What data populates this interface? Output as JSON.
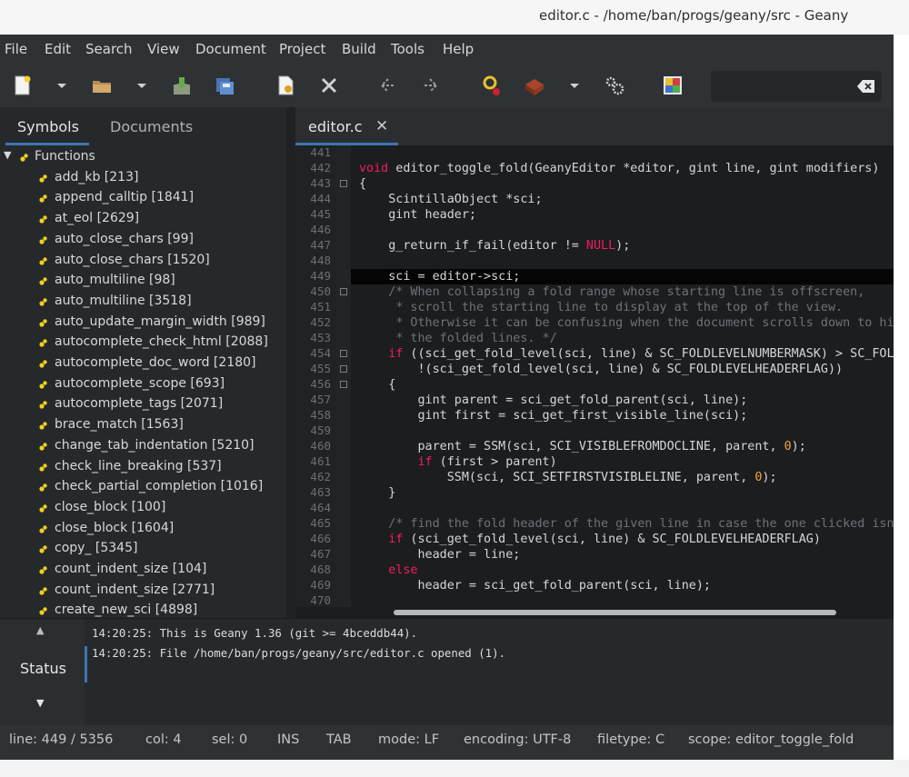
{
  "window": {
    "title": "editor.c - /home/ban/progs/geany/src - Geany"
  },
  "menu": [
    "File",
    "Edit",
    "Search",
    "View",
    "Document",
    "Project",
    "Build",
    "Tools",
    "Help"
  ],
  "toolbar": {
    "buttons": [
      "new-file",
      "new-dropdown",
      "open-file",
      "open-dropdown",
      "save",
      "save-all",
      "revert",
      "close",
      "navigate-back",
      "navigate-forward",
      "compile",
      "build",
      "build-dropdown",
      "run-preferences",
      "color-chooser"
    ],
    "search": {
      "value": "",
      "placeholder": ""
    }
  },
  "sidebar": {
    "tabs": [
      "Symbols",
      "Documents"
    ],
    "active_tab": "Symbols",
    "group": "Functions",
    "symbols": [
      "add_kb [213]",
      "append_calltip [1841]",
      "at_eol [2629]",
      "auto_close_chars [99]",
      "auto_close_chars [1520]",
      "auto_multiline [98]",
      "auto_multiline [3518]",
      "auto_update_margin_width [989]",
      "autocomplete_check_html [2088]",
      "autocomplete_doc_word [2180]",
      "autocomplete_scope [693]",
      "autocomplete_tags [2071]",
      "brace_match [1563]",
      "change_tab_indentation [5210]",
      "check_line_breaking [537]",
      "check_partial_completion [1016]",
      "close_block [100]",
      "close_block [1604]",
      "copy_ [5345]",
      "count_indent_size [104]",
      "count_indent_size [2771]",
      "create_new_sci [4898]"
    ]
  },
  "editor": {
    "tab_label": "editor.c",
    "close_glyph": "✕",
    "current_line": 449,
    "line_numbers": [
      441,
      442,
      443,
      444,
      445,
      446,
      447,
      448,
      449,
      450,
      451,
      452,
      453,
      454,
      455,
      456,
      457,
      458,
      459,
      460,
      461,
      462,
      463,
      464,
      465,
      466,
      467,
      468,
      469,
      470
    ],
    "fold_markers": [
      443,
      450,
      454,
      455,
      456
    ],
    "code": [
      "",
      "void editor_toggle_fold(GeanyEditor *editor, gint line, gint modifiers)",
      "{",
      "    ScintillaObject *sci;",
      "    gint header;",
      "",
      "    g_return_if_fail(editor != NULL);",
      "",
      "    sci = editor->sci;",
      "    /* When collapsing a fold range whose starting line is offscreen,",
      "     * scroll the starting line to display at the top of the view.",
      "     * Otherwise it can be confusing when the document scrolls down to hide",
      "     * the folded lines. */",
      "    if ((sci_get_fold_level(sci, line) & SC_FOLDLEVELNUMBERMASK) > SC_FOLDLEVELBASE &&",
      "        !(sci_get_fold_level(sci, line) & SC_FOLDLEVELHEADERFLAG))",
      "    {",
      "        gint parent = sci_get_fold_parent(sci, line);",
      "        gint first = sci_get_first_visible_line(sci);",
      "",
      "        parent = SSM(sci, SCI_VISIBLEFROMDOCLINE, parent, 0);",
      "        if (first > parent)",
      "            SSM(sci, SCI_SETFIRSTVISIBLELINE, parent, 0);",
      "    }",
      "",
      "    /* find the fold header of the given line in case the one clicked isn't a fold point */",
      "    if (sci_get_fold_level(sci, line) & SC_FOLDLEVELHEADERFLAG)",
      "        header = line;",
      "    else",
      "        header = sci_get_fold_parent(sci, line);",
      ""
    ],
    "horizontal_scroll_fraction": 0.74
  },
  "messages": {
    "tab": "Status",
    "log": [
      "14:20:25: This is Geany 1.36 (git >= 4bceddb44).",
      "14:20:25: File /home/ban/progs/geany/src/editor.c opened (1)."
    ]
  },
  "statusbar": {
    "line": "line: 449 / 5356",
    "col": "col: 4",
    "sel": "sel: 0",
    "ins": "INS",
    "tab": "TAB",
    "mode": "mode: LF",
    "encoding": "encoding: UTF-8",
    "filetype": "filetype: C",
    "scope": "scope: editor_toggle_fold"
  },
  "colors": {
    "accent": "#3d75b5",
    "keyword": "#f01d5c",
    "comment": "#6d7278",
    "number": "#f2a53a",
    "editor_bg": "#1c1d1f"
  }
}
